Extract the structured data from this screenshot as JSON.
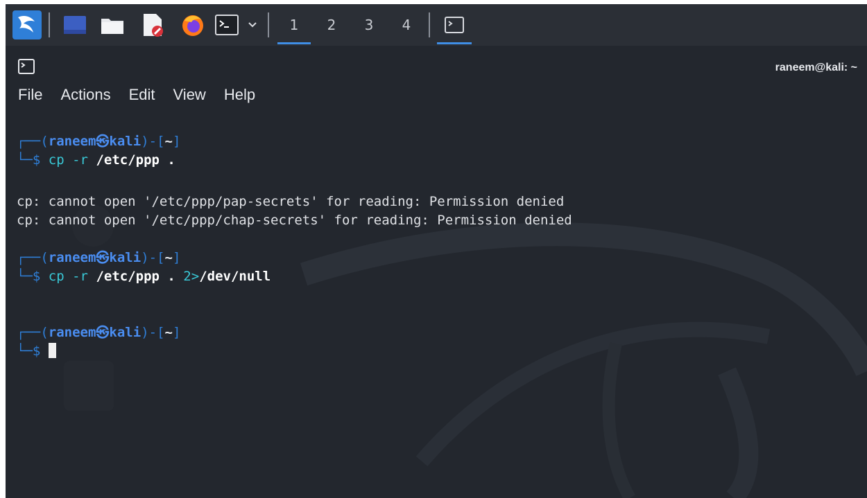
{
  "taskbar": {
    "workspaces": [
      "1",
      "2",
      "3",
      "4"
    ],
    "active_workspace": "1"
  },
  "window": {
    "title": "raneem@kali: ~"
  },
  "menu": {
    "items": [
      "File",
      "Actions",
      "Edit",
      "View",
      "Help"
    ]
  },
  "terminal": {
    "prompt": {
      "open": "┌──(",
      "user": "raneem",
      "at": "㉿",
      "host": "kali",
      "close": ")-[",
      "dir": "~",
      "end": "]",
      "line2": "└─",
      "dollar": "$"
    },
    "cmd1": {
      "bin": "cp -r",
      "args": "/etc/ppp ."
    },
    "errors": [
      "cp: cannot open '/etc/ppp/pap-secrets' for reading: Permission denied",
      "cp: cannot open '/etc/ppp/chap-secrets' for reading: Permission denied"
    ],
    "cmd2": {
      "bin": "cp -r",
      "args": "/etc/ppp .",
      "redir": "2>",
      "target": "/dev/null"
    }
  },
  "colors": {
    "background": "#23272e",
    "prompt_frame": "#2f7fd8",
    "prompt_user": "#4a8df0",
    "command": "#39c8d6",
    "accent": "#3f8ee6"
  }
}
